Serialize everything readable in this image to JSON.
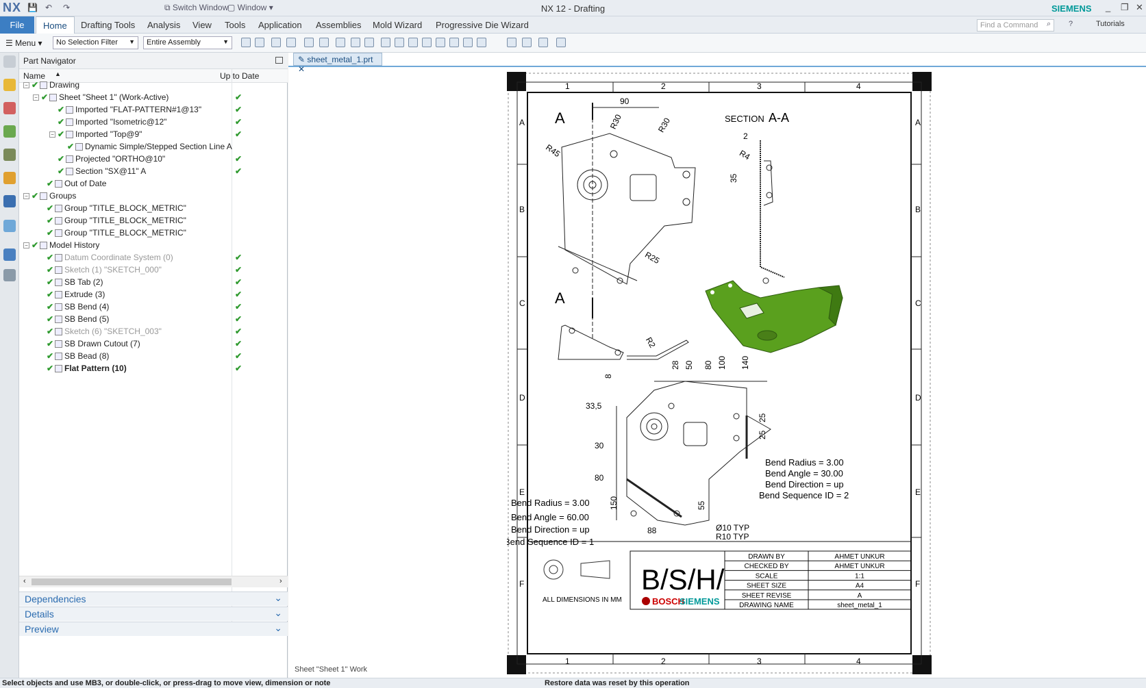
{
  "titlebar": {
    "app": "NX",
    "switch_window": "Switch Window",
    "window": "Window",
    "title": "NX 12 - Drafting",
    "brand": "SIEMENS",
    "tutorials": "Tutorials"
  },
  "ribbon": {
    "tabs": [
      "File",
      "Home",
      "Drafting Tools",
      "Analysis",
      "View",
      "Tools",
      "Application",
      "Assemblies",
      "Mold Wizard",
      "Progressive Die Wizard"
    ],
    "find_placeholder": "Find a Command"
  },
  "toolbar": {
    "menu": "Menu",
    "selection_filter": "No Selection Filter",
    "assembly_scope": "Entire Assembly"
  },
  "navigator": {
    "title": "Part Navigator",
    "col_name": "Name",
    "col_uptodate": "Up to Date",
    "rows": [
      {
        "label": "Drawing",
        "ok": false
      },
      {
        "label": "Sheet \"Sheet 1\" (Work-Active)",
        "ok": true
      },
      {
        "label": "Imported \"FLAT-PATTERN#1@13\"",
        "ok": true
      },
      {
        "label": "Imported \"Isometric@12\"",
        "ok": true
      },
      {
        "label": "Imported \"Top@9\"",
        "ok": true
      },
      {
        "label": "Dynamic Simple/Stepped Section Line A",
        "ok": false
      },
      {
        "label": "Projected \"ORTHO@10\"",
        "ok": true
      },
      {
        "label": "Section \"SX@11\" A",
        "ok": true
      },
      {
        "label": "Out of Date",
        "ok": false
      },
      {
        "label": "Groups",
        "ok": false
      },
      {
        "label": "Group \"TITLE_BLOCK_METRIC\"",
        "ok": false
      },
      {
        "label": "Group \"TITLE_BLOCK_METRIC\"",
        "ok": false
      },
      {
        "label": "Group \"TITLE_BLOCK_METRIC\"",
        "ok": false
      },
      {
        "label": "Model History",
        "ok": false
      },
      {
        "label": "Datum Coordinate System (0)",
        "ok": true
      },
      {
        "label": "Sketch (1) \"SKETCH_000\"",
        "ok": true
      },
      {
        "label": "SB Tab (2)",
        "ok": true
      },
      {
        "label": "Extrude (3)",
        "ok": true
      },
      {
        "label": "SB Bend (4)",
        "ok": true
      },
      {
        "label": "SB Bend (5)",
        "ok": true
      },
      {
        "label": "Sketch (6) \"SKETCH_003\"",
        "ok": true
      },
      {
        "label": "SB Drawn Cutout (7)",
        "ok": true
      },
      {
        "label": "SB Bead (8)",
        "ok": true
      },
      {
        "label": "Flat Pattern (10)",
        "ok": true
      }
    ],
    "panels": [
      "Dependencies",
      "Details",
      "Preview"
    ]
  },
  "document": {
    "tab": "sheet_metal_1.prt",
    "sheet_label": "Sheet \"Sheet 1\" Work"
  },
  "drawing": {
    "cols": [
      "1",
      "2",
      "3",
      "4"
    ],
    "rows": [
      "A",
      "B",
      "C",
      "D",
      "E",
      "F"
    ],
    "section_title": "SECTION",
    "section_id": "A-A",
    "section_letter": "A",
    "dims": {
      "d90": "90",
      "r30a": "R30",
      "r30b": "R30",
      "r45": "R45",
      "r25": "R25",
      "r2": "R2",
      "r4": "R4",
      "d2": "2",
      "d35": "35",
      "d8": "8",
      "d28": "28",
      "d50": "50",
      "d80a": "80",
      "d100": "100",
      "d140": "140",
      "d33": "33,5",
      "d30": "30",
      "d80b": "80",
      "d150": "150",
      "d55": "55",
      "d88": "88",
      "d25a": "25",
      "d25b": "25",
      "typ1": "Ø10 TYP",
      "typ2": "R10 TYP"
    },
    "bend1": [
      "Bend Radius = 3.00",
      "Bend Angle = 30.00",
      "Bend Direction = up",
      "Bend Sequence ID = 2"
    ],
    "bend2": [
      "Bend Radius = 3.00",
      "Bend Angle = 60.00",
      "Bend Direction = up",
      "Bend Sequence ID = 1"
    ],
    "title_block": {
      "all_dims": "ALL DIMENSIONS IN MM",
      "logo_text": "B/S/H/",
      "bosch": "BOSCH",
      "siemens": "SIEMENS",
      "fields": [
        [
          "DRAWN BY",
          "AHMET UNKUR"
        ],
        [
          "CHECKED BY",
          "AHMET UNKUR"
        ],
        [
          "SCALE",
          "1:1"
        ],
        [
          "SHEET SIZE",
          "A4"
        ],
        [
          "SHEET REVISE",
          "A"
        ],
        [
          "DRAWING NAME",
          "sheet_metal_1"
        ]
      ]
    }
  },
  "status": {
    "left": "Select objects and use MB3, or double-click, or press-drag to move view, dimension or note",
    "right": "Restore data was reset by this operation"
  },
  "colors": {
    "accent": "#3c7ec3",
    "model_green": "#5aa01e",
    "check_green": "#2f9a2f"
  }
}
